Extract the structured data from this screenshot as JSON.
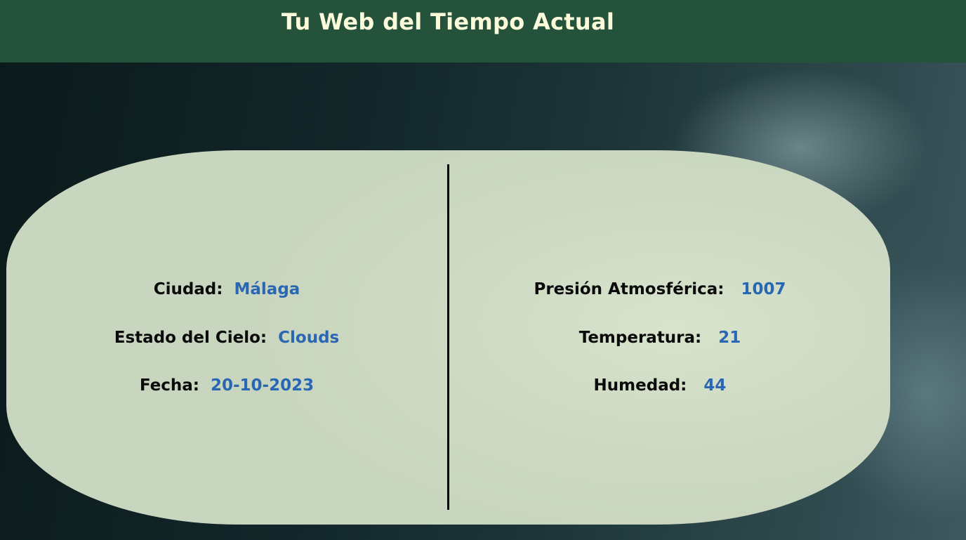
{
  "header": {
    "title": "Tu Web del Tiempo Actual"
  },
  "weather": {
    "left": [
      {
        "label": "Ciudad:",
        "value": "Málaga"
      },
      {
        "label": "Estado del Cielo:",
        "value": "Clouds"
      },
      {
        "label": "Fecha:",
        "value": "20-10-2023"
      }
    ],
    "right": [
      {
        "label": "Presión Atmosférica:",
        "value": "1007"
      },
      {
        "label": "Temperatura:",
        "value": "21"
      },
      {
        "label": "Humedad:",
        "value": "44"
      }
    ]
  },
  "colors": {
    "header_bg": "#24523a",
    "title_text": "#fbfbdc",
    "card_bg": "#cdd9c2",
    "value_text": "#2a67b3",
    "label_text": "#0b0b0b"
  }
}
